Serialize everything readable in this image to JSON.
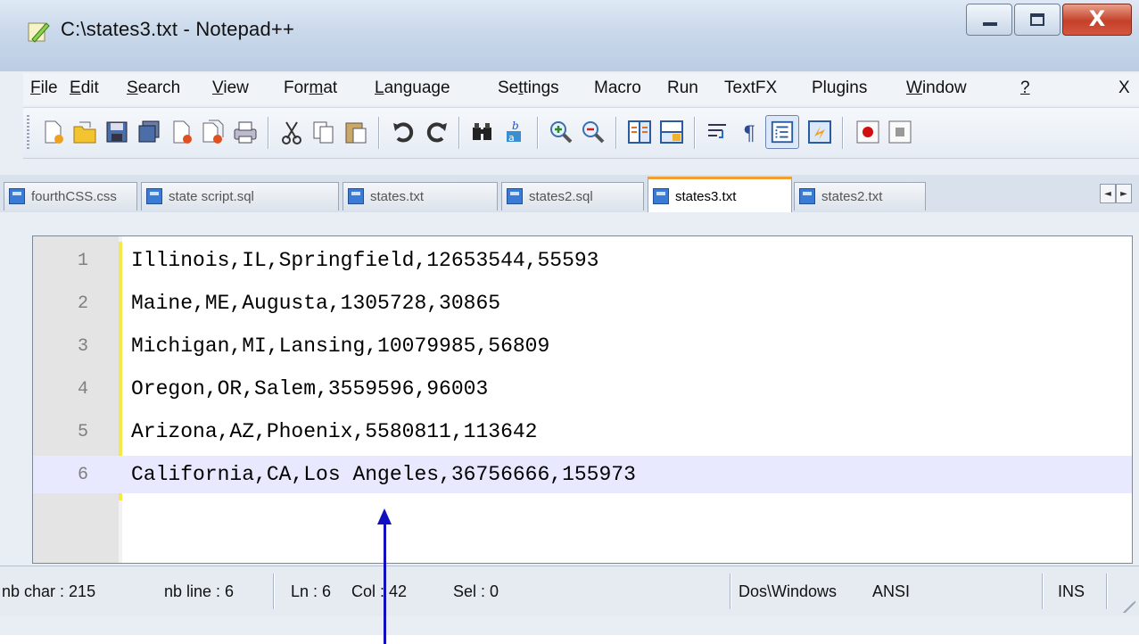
{
  "window": {
    "title": "C:\\states3.txt - Notepad++"
  },
  "window_controls": {
    "close_glyph": "X"
  },
  "menu": [
    {
      "label": "File",
      "u": "F",
      "rest": "ile"
    },
    {
      "label": "Edit",
      "u": "E",
      "rest": "dit"
    },
    {
      "label": "Search",
      "u": "S",
      "rest": "earch"
    },
    {
      "label": "View",
      "u": "V",
      "rest": "iew"
    },
    {
      "label": "Format",
      "pre": "For",
      "u": "m",
      "rest": "at"
    },
    {
      "label": "Language",
      "u": "L",
      "rest": "anguage"
    },
    {
      "label": "Settings",
      "pre": "Se",
      "u": "t",
      "rest": "tings"
    },
    {
      "label": "Macro"
    },
    {
      "label": "Run"
    },
    {
      "label": "TextFX"
    },
    {
      "label": "Plugins"
    },
    {
      "label": "Window",
      "u": "W",
      "rest": "indow"
    },
    {
      "label": "?",
      "u": "?"
    },
    {
      "label": "X"
    }
  ],
  "tabs": [
    {
      "label": "fourthCSS.css"
    },
    {
      "label": "state script.sql"
    },
    {
      "label": "states.txt"
    },
    {
      "label": "states2.sql"
    },
    {
      "label": "states3.txt",
      "active": true
    },
    {
      "label": "states2.txt"
    }
  ],
  "tab_nav": {
    "prev": "◄",
    "next": "►"
  },
  "editor": {
    "current_line": 6,
    "lines": [
      {
        "num": "1",
        "text": "Illinois,IL,Springfield,12653544,55593"
      },
      {
        "num": "2",
        "text": "Maine,ME,Augusta,1305728,30865"
      },
      {
        "num": "3",
        "text": "Michigan,MI,Lansing,10079985,56809"
      },
      {
        "num": "4",
        "text": "Oregon,OR,Salem,3559596,96003"
      },
      {
        "num": "5",
        "text": "Arizona,AZ,Phoenix,5580811,113642"
      },
      {
        "num": "6",
        "text": "California,CA,Los Angeles,36756666,155973"
      }
    ]
  },
  "status": {
    "nb_char": "nb char : 215",
    "nb_line": "nb line : 6",
    "ln": "Ln : 6",
    "col": "Col : 42",
    "sel": "Sel : 0",
    "eol": "Dos\\Windows",
    "encoding": "ANSI",
    "mode": "INS"
  },
  "colors": {
    "current_line_bg": "#e8e8ff",
    "active_tab_accent": "#f0a030",
    "annotation_arrow": "#1010c0",
    "change_bar": "#f4e94a"
  }
}
